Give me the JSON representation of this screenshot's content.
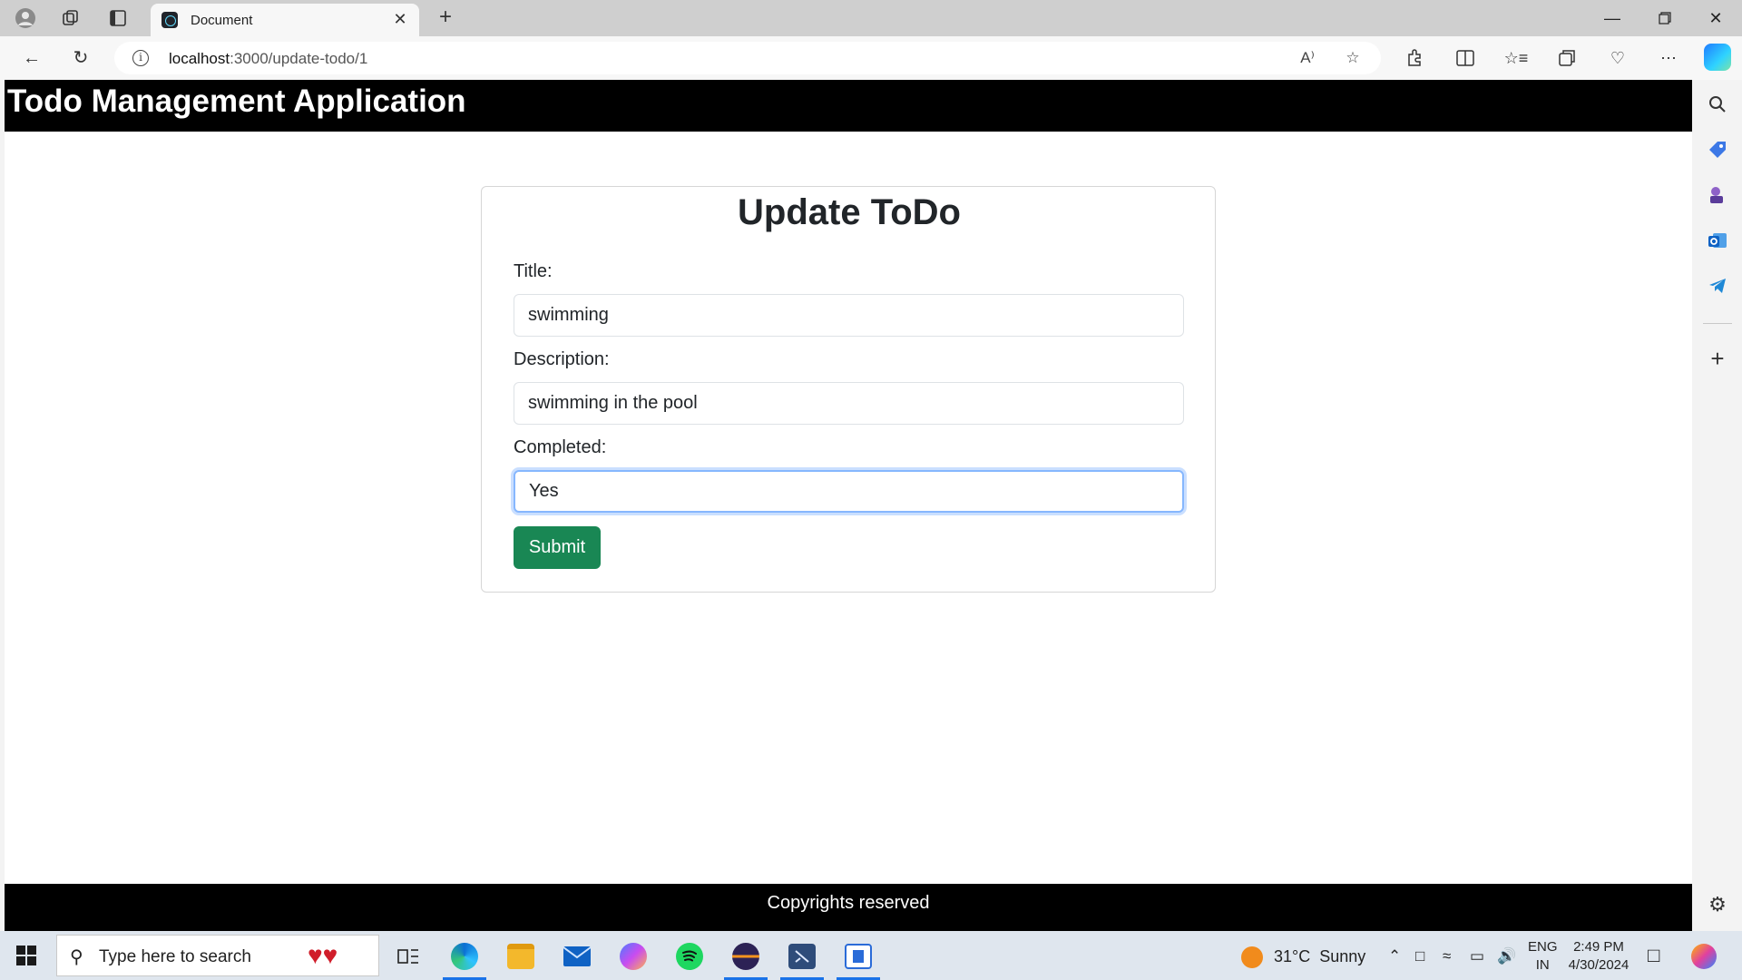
{
  "browser": {
    "tab_title": "Document",
    "url_host": "localhost",
    "url_path": ":3000/update-todo/1",
    "tab_close_glyph": "✕",
    "new_tab_glyph": "+",
    "icons": [
      "profile-icon",
      "workspaces-icon",
      "tab-actions-icon",
      "back-icon",
      "refresh-icon",
      "info-icon",
      "read-aloud-icon",
      "favorite-icon",
      "extensions-icon",
      "split-screen-icon",
      "favorites-icon",
      "collections-icon",
      "browser-essentials-icon",
      "more-icon",
      "copilot-icon"
    ]
  },
  "app": {
    "header_title": "Todo Management Application",
    "form": {
      "heading": "Update ToDo",
      "title_label": "Title:",
      "title_value": "swimming",
      "description_label": "Description:",
      "description_value": "swimming in the pool",
      "completed_label": "Completed:",
      "completed_value": "Yes",
      "submit_label": "Submit"
    },
    "footer_text": "Copyrights reserved"
  },
  "colors": {
    "header_bg": "#000000",
    "submit_bg": "#198754",
    "focus_ring": "#86b7fe",
    "page_bg": "#ffffff"
  },
  "sidebar_icons": [
    "search-icon",
    "shopping-tag-icon",
    "games-icon",
    "outlook-icon",
    "telegram-icon",
    "add-icon",
    "settings-icon"
  ],
  "taskbar": {
    "search_placeholder": "Type here to search",
    "apps": [
      "task-view-icon",
      "edge-icon",
      "file-explorer-icon",
      "mail-icon",
      "copilot-app-icon",
      "spotify-icon",
      "eclipse-icon",
      "visual-studio-icon",
      "app-window-icon"
    ],
    "weather_temp": "31°C",
    "weather_desc": "Sunny",
    "lang_line1": "ENG",
    "lang_line2": "IN",
    "time": "2:49 PM",
    "date": "4/30/2024"
  }
}
